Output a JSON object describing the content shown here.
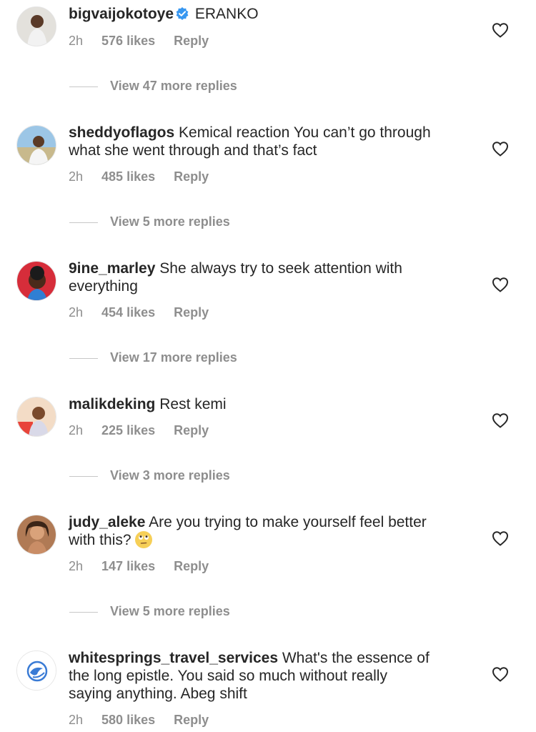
{
  "comments": [
    {
      "username": "bigvaijokotoye",
      "verified": true,
      "text": "ERANKO",
      "time": "2h",
      "likes": "576 likes",
      "reply": "Reply",
      "view_replies": "View 47 more replies"
    },
    {
      "username": "sheddyoflagos",
      "text_l1": "Kemical reaction You can’t go through",
      "text_l2": "what she went through and that’s fact",
      "time": "2h",
      "likes": "485 likes",
      "reply": "Reply",
      "view_replies": "View 5 more replies"
    },
    {
      "username": "9ine_marley",
      "text_l1": "She always try to seek attention with",
      "text_l2": "everything",
      "time": "2h",
      "likes": "454 likes",
      "reply": "Reply",
      "view_replies": "View 17 more replies"
    },
    {
      "username": "malikdeking",
      "text": "Rest kemi",
      "time": "2h",
      "likes": "225 likes",
      "reply": "Reply",
      "view_replies": "View 3 more replies"
    },
    {
      "username": "judy_aleke",
      "text_l1": "Are you trying to make yourself feel better",
      "text_l2": "with this?",
      "emoji": "face-with-rolling-eyes",
      "time": "2h",
      "likes": "147 likes",
      "reply": "Reply",
      "view_replies": "View 5 more replies"
    },
    {
      "username": "whitesprings_travel_services",
      "text_l1": "What's the essence of",
      "text_l2": "the long epistle. You said so much without really",
      "text_l3": "saying anything. Abeg shift",
      "time": "2h",
      "likes": "580 likes",
      "reply": "Reply"
    }
  ],
  "colors": {
    "text": "#262626",
    "muted": "#8e8e8e",
    "verified": "#3897f0",
    "background": "#ffffff"
  }
}
